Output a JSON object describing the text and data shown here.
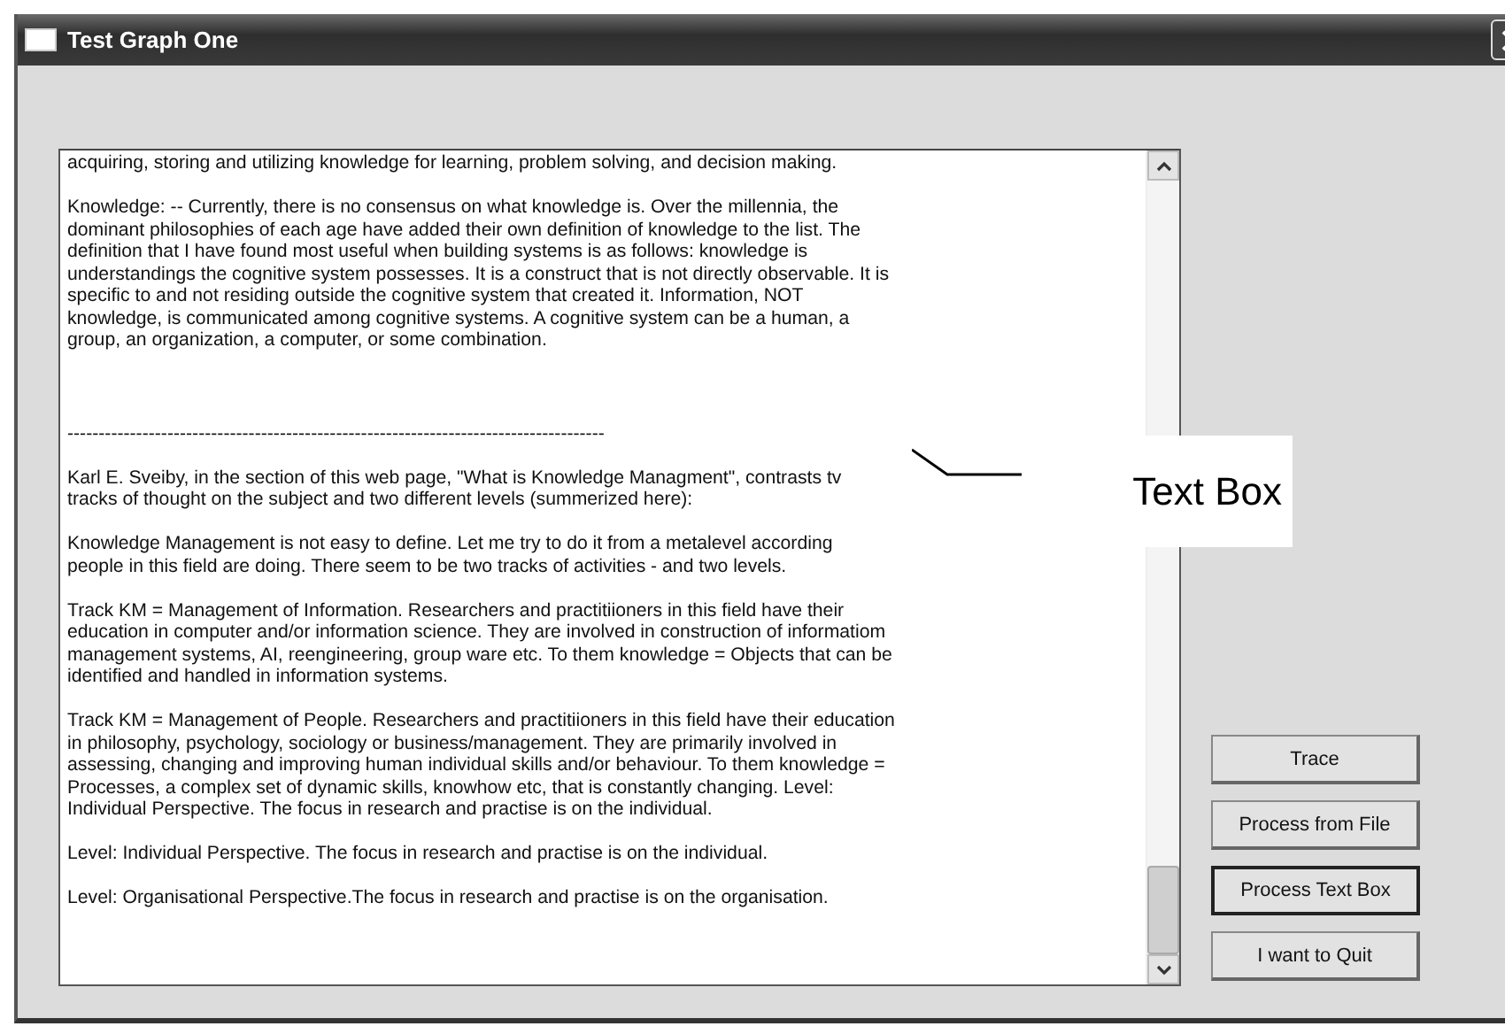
{
  "window": {
    "title": "Test Graph One"
  },
  "text_box": {
    "paragraphs": [
      {
        "kind": "text",
        "lines": [
          "acquiring, storing and utilizing knowledge for learning, problem solving, and decision making."
        ]
      },
      {
        "kind": "text",
        "lines": [
          "Knowledge: -- Currently, there is no consensus on what knowledge is. Over the millennia, the",
          "dominant philosophies of each age have added their own definition of knowledge to the list. The",
          "definition that I have found most useful when building systems is as follows: knowledge is",
          "understandings the cognitive system possesses. It is a construct that is not directly observable. It is",
          "specific to and not residing outside the cognitive system that created it. Information, NOT",
          "knowledge, is communicated among cognitive systems. A cognitive system can be a human, a",
          "group, an organization, a computer, or some combination."
        ]
      },
      {
        "kind": "rule",
        "lines": [
          "--------------------------------------------------------------------------------------"
        ]
      },
      {
        "kind": "text",
        "lines": [
          "Karl E. Sveiby, in the section of this web page, \"What is Knowledge Managment\", contrasts tv",
          "tracks of thought on the subject and two different levels (summerized here):"
        ]
      },
      {
        "kind": "text",
        "lines": [
          "Knowledge Management is not easy to define. Let me try to do it from a metalevel according",
          "people in this field are doing. There seem to be two tracks of activities - and two levels."
        ]
      },
      {
        "kind": "text",
        "lines": [
          "Track KM = Management of Information. Researchers and practitiioners in this field have their",
          "education in computer and/or information science. They are involved in construction of informatiom",
          "management systems, AI, reengineering, group ware etc. To them knowledge = Objects that can be",
          "identified and handled in information systems."
        ]
      },
      {
        "kind": "text",
        "lines": [
          "Track KM = Management of People. Researchers and practitiioners in this field have their education",
          "in philosophy, psychology, sociology or business/management. They are primarily involved in",
          "assessing, changing and improving human individual skills and/or behaviour. To them knowledge =",
          "Processes, a complex set of dynamic skills, knowhow etc, that is constantly changing. Level:",
          "Individual Perspective. The focus in research and practise is on the individual."
        ]
      },
      {
        "kind": "text",
        "lines": [
          "Level: Individual Perspective. The focus in research and practise is on the individual."
        ]
      },
      {
        "kind": "text",
        "lines": [
          "Level: Organisational Perspective.The focus in research and practise is on the organisation."
        ]
      }
    ]
  },
  "callout": {
    "label": "Text Box"
  },
  "buttons": [
    {
      "label": "Trace",
      "focused": false
    },
    {
      "label": "Process from File",
      "focused": false
    },
    {
      "label": "Process Text Box",
      "focused": true
    },
    {
      "label": "I want to Quit",
      "focused": false
    }
  ]
}
